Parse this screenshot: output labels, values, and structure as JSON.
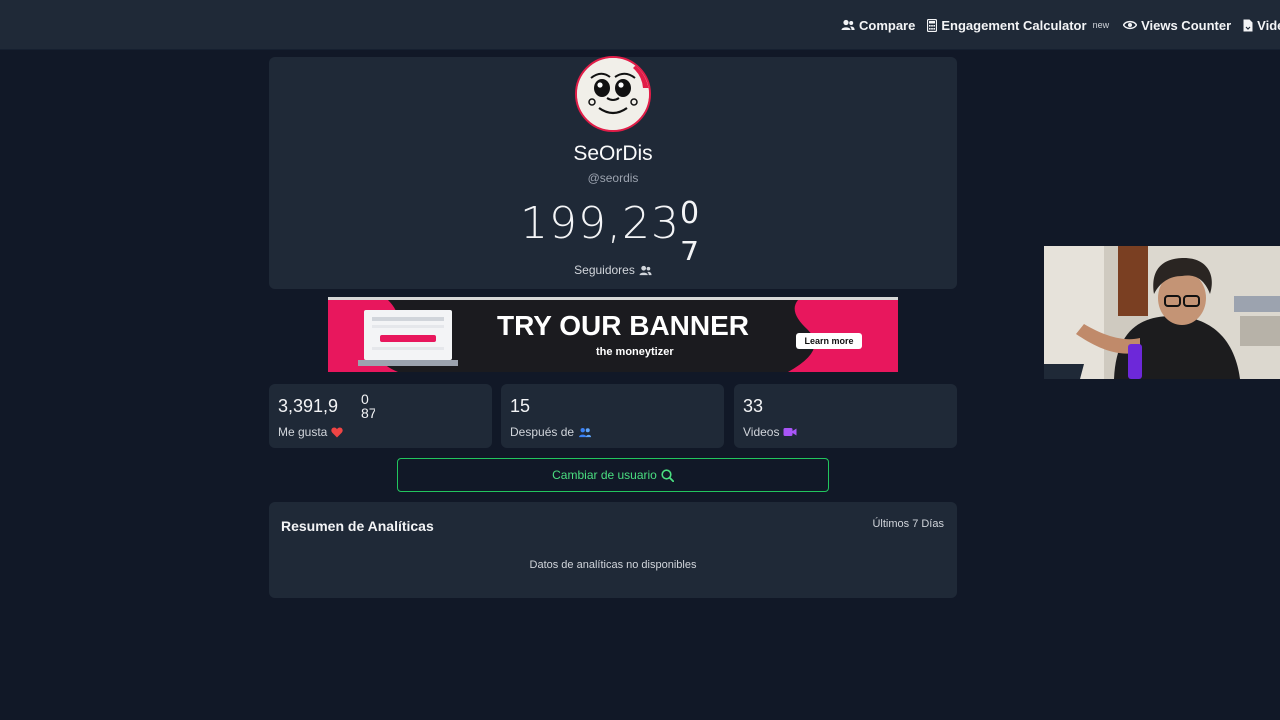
{
  "nav": {
    "compare": "Compare",
    "engagement": "Engagement Calculator",
    "engagement_badge": "new",
    "views": "Views Counter",
    "video": "Video D"
  },
  "profile": {
    "name": "SeOrDis",
    "handle": "@seordis",
    "followers_main": "199,23",
    "followers_digit_top": "0",
    "followers_digit_bottom": "7",
    "followers_label": "Seguidores"
  },
  "banner": {
    "headline": "TRY OUR BANNER",
    "brand": "the moneytizer",
    "cta": "Learn more"
  },
  "stats": [
    {
      "value": "3,391,9",
      "roll_top": "0",
      "roll_bottom": "87",
      "label": "Me gusta",
      "icon": "heart-icon"
    },
    {
      "value": "15",
      "label": "Después de",
      "icon": "users-icon"
    },
    {
      "value": "33",
      "label": "Videos",
      "icon": "video-camera-icon"
    }
  ],
  "switch_user": "Cambiar de usuario",
  "analytics": {
    "title": "Resumen de Analíticas",
    "range": "Últimos 7 Días",
    "empty": "Datos de analíticas no disponibles"
  },
  "colors": {
    "background": "#111827",
    "card": "#1f2937",
    "accent_green": "#22c55e",
    "heart": "#ef4444",
    "banner_pink": "#e8175d"
  }
}
